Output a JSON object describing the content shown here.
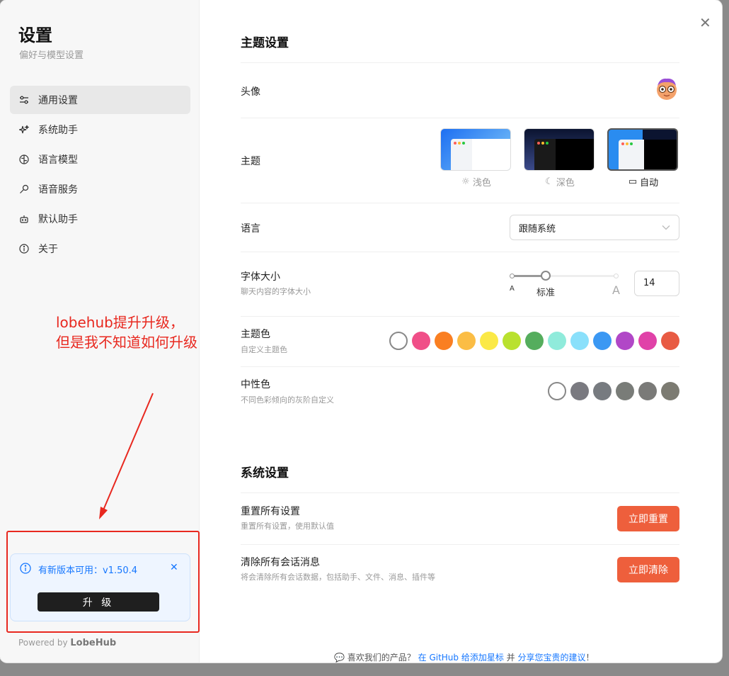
{
  "sidebar": {
    "title": "设置",
    "subtitle": "偏好与模型设置",
    "items": [
      {
        "label": "通用设置",
        "icon": "sliders-icon"
      },
      {
        "label": "系统助手",
        "icon": "sparkles-icon"
      },
      {
        "label": "语言模型",
        "icon": "brain-icon"
      },
      {
        "label": "语音服务",
        "icon": "microphone-icon"
      },
      {
        "label": "默认助手",
        "icon": "bot-icon"
      },
      {
        "label": "关于",
        "icon": "info-icon"
      }
    ],
    "update": {
      "message": "有新版本可用：v1.50.4",
      "button_label": "升 级"
    },
    "powered_prefix": "Powered by",
    "powered_brand": "LobeHub"
  },
  "annotation": {
    "line1": "lobehub提升升级，",
    "line2": "但是我不知道如何升级",
    "color": "#e8281f"
  },
  "theme_section": {
    "title": "主题设置",
    "avatar_label": "头像",
    "theme_label": "主题",
    "themes": [
      {
        "label": "浅色",
        "icon": "sun-icon"
      },
      {
        "label": "深色",
        "icon": "moon-icon"
      },
      {
        "label": "自动",
        "icon": "monitor-icon",
        "selected": true
      }
    ],
    "language_label": "语言",
    "language_value": "跟随系统",
    "font_label": "字体大小",
    "font_desc": "聊天内容的字体大小",
    "font_small_mark": "A",
    "font_mid_mark": "标准",
    "font_large_mark": "A",
    "font_value": "14",
    "primary_label": "主题色",
    "primary_desc": "自定义主题色",
    "primary_colors": [
      "#ffffff",
      "#f04f88",
      "#fa7f22",
      "#fbbd45",
      "#fbe946",
      "#b9e12f",
      "#55ad5d",
      "#90ebdb",
      "#8ae0fb",
      "#3b98f3",
      "#b147c7",
      "#e042a8",
      "#e85b43"
    ],
    "neutral_label": "中性色",
    "neutral_desc": "不同色彩倾向的灰阶自定义",
    "neutral_colors": [
      "#ffffff",
      "#7a7a80",
      "#777b80",
      "#797c78",
      "#7a7a78",
      "#7c7b72"
    ]
  },
  "system_section": {
    "title": "系统设置",
    "reset_label": "重置所有设置",
    "reset_desc": "重置所有设置，使用默认值",
    "reset_button": "立即重置",
    "clear_label": "清除所有会话消息",
    "clear_desc": "将会清除所有会话数据，包括助手、文件、消息、插件等",
    "clear_button": "立即清除"
  },
  "footer": {
    "prefix": "喜欢我们的产品？",
    "link1": "在 GitHub 给添加星标",
    "middle": "并",
    "link2": "分享您宝贵的建议",
    "suffix": "！"
  }
}
